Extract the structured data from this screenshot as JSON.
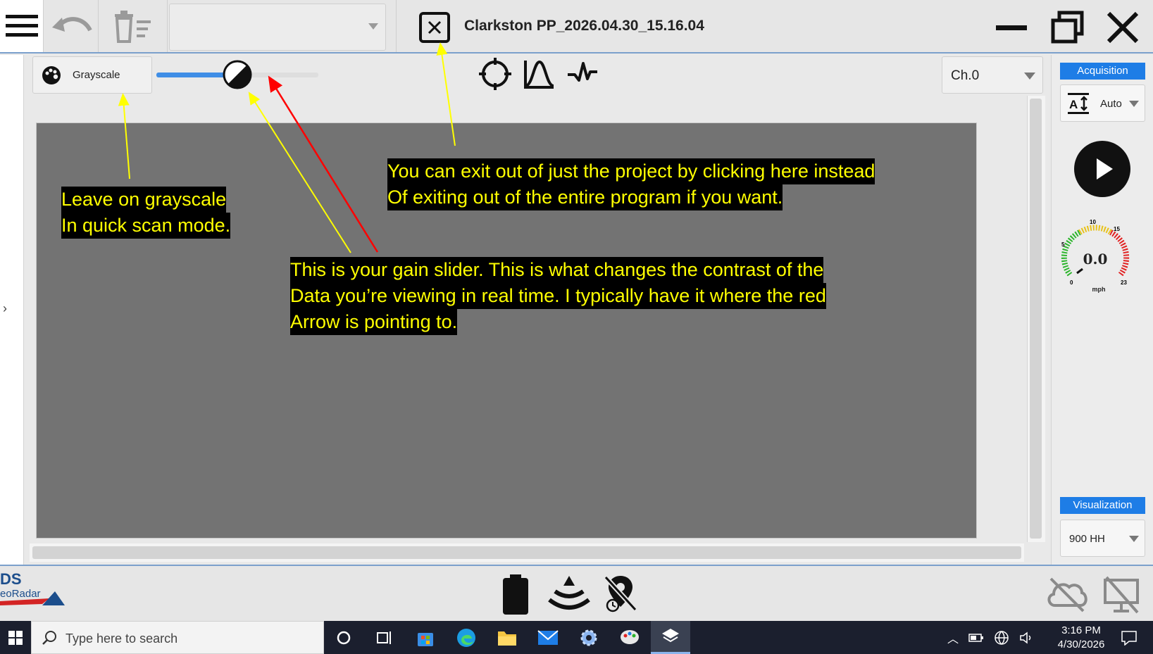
{
  "window": {
    "project_title": "Clarkston PP_2026.04.30_15.16.04"
  },
  "toolbar": {
    "top_select_value": ""
  },
  "controls": {
    "color_map_label": "Grayscale",
    "gain_slider_level_fraction": 0.5,
    "channel_label": "Ch.0"
  },
  "right_panel": {
    "acquisition_label": "Acquisition",
    "auto_label": "Auto",
    "speed_value": "0.0",
    "speed_unit": "mph",
    "gauge_ticks": [
      "0",
      "5",
      "10",
      "15",
      "23"
    ],
    "visualization_label": "Visualization",
    "antenna_label": "900 HH"
  },
  "branding": {
    "line1": "DS",
    "line2": "eoRadar"
  },
  "taskbar": {
    "search_placeholder": "Type here to search",
    "time": "3:16 PM",
    "date": "4/30/2026"
  },
  "annotations": {
    "grayscale_note": [
      "Leave on grayscale",
      "In quick scan mode."
    ],
    "exit_note": [
      "You can exit out of just the project by clicking here instead",
      "Of exiting out of the entire program if you want."
    ],
    "gain_note": [
      "This is your gain slider. This is what changes the contrast of the",
      "Data you’re viewing in real time. I typically have it where the red",
      "Arrow is pointing to."
    ]
  },
  "colors": {
    "accent_blue": "#1e7de6",
    "scan_area_gray": "#737373",
    "annotation_text": "#ffff00",
    "annotation_bg": "#000000",
    "arrow_yellow": "#ffff00",
    "arrow_red": "#ff0000"
  },
  "icons": {
    "menu": "hamburger-menu-icon",
    "undo": "undo-icon",
    "delete": "delete-list-icon",
    "close_project": "close-square-icon",
    "minimize": "minimize-icon",
    "maximize": "restore-icon",
    "close": "close-icon",
    "palette": "palette-icon",
    "crosshair": "crosshair-icon",
    "peak": "wave-peak-icon",
    "signal": "pulse-icon",
    "play": "play-icon",
    "battery": "battery-icon",
    "gps": "gps-signal-icon",
    "no_odometer": "odometer-off-icon",
    "cloud_off": "cloud-off-icon",
    "monitor_off": "monitor-off-icon"
  }
}
